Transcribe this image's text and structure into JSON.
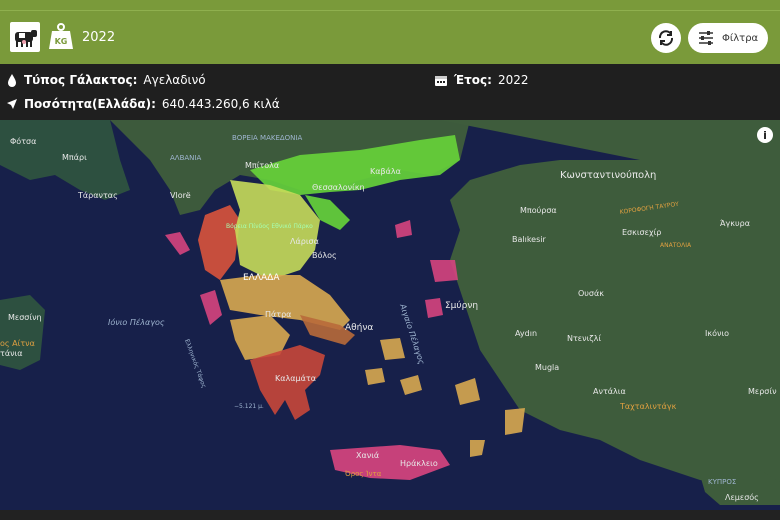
{
  "header": {
    "year": "2022",
    "filter_label": "Φίλτρα"
  },
  "info": {
    "milk_type_label": "Τύπος Γάλακτος:",
    "milk_type_value": "Αγελαδινό",
    "year_label": "Έτος:",
    "year_value": "2022",
    "quantity_label": "Ποσότητα(Ελλάδα):",
    "quantity_value": "640.443.260,6 κιλά"
  },
  "map": {
    "labels": {
      "fotsa": "Φότσα",
      "bari": "Μπάρι",
      "taranto": "Τάραντας",
      "albania": "ΑΛΒΑΝΙΑ",
      "vlore": "Vlorë",
      "north_macedonia": "ΒΟΡΕΙΑ ΜΑΚΕΔΟΝΙΑ",
      "bitola": "Μπίτολα",
      "kavala": "Καβάλα",
      "thessaloniki": "Θεσσαλονίκη",
      "constantinople": "Κωνσταντινούπολη",
      "bursa": "Μπούρσα",
      "ankara": "Άγκυρα",
      "eskisehir": "Εσκισεχίρ",
      "balikesir": "Balıkesir",
      "larisa": "Λάρισα",
      "volos": "Βόλος",
      "greece": "ΕΛΛΑΔΑ",
      "patra": "Πάτρα",
      "athens": "Αθήνα",
      "smyrni": "Σμύρνη",
      "usak": "Ουσάκ",
      "aydin": "Aydın",
      "denizli": "Ντενιζλί",
      "konya": "Ικόνιο",
      "mugla": "Mugla",
      "antalya": "Αντάλια",
      "taxtali": "Ταχταλιντάγκ",
      "mersin": "Μερσίν",
      "kalamata": "Καλαμάτα",
      "chania": "Χανιά",
      "heraklion": "Ηράκλειο",
      "ida": "Όρος Ίντα",
      "cyprus": "ΚΥΠΡΟΣ",
      "lemesos": "Λεμεσός",
      "messina": "Μεσσίνη",
      "aitna": "ος Αίτνα",
      "katania": "τάνια",
      "ionian_sea": "Ιόνιο Πέλαγος",
      "aegean": "Αιγαίο Πέλαγος",
      "ellinikos": "Ελληνικός Τάφος",
      "depth": "−5.121 μ.",
      "pindos": "Βόρεια Πίνδος Εθνικό Πάρκο",
      "taurus": "ΚΟΡΟΦΟΓΗ ΤΑΥΡΟΥ",
      "anatolia": "ΑΝΑΤΟΛΙΑ"
    }
  }
}
